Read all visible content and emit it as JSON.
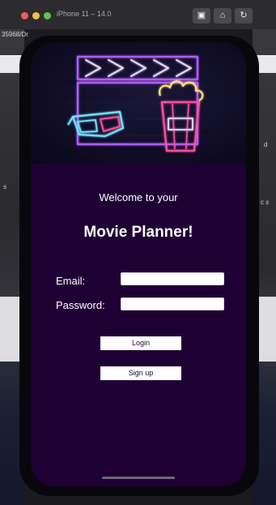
{
  "simulator": {
    "title": "iPhone 11 – 14.0",
    "buttons": {
      "screenshot_icon": "camera-icon",
      "home_icon": "home-icon",
      "rotate_icon": "rotate-icon"
    }
  },
  "background": {
    "path_fragment": "35968/Dr",
    "right_glyph_1": "d",
    "right_glyph_2": "c  s",
    "left_glyph": "s"
  },
  "app": {
    "welcome": "Welcome to your",
    "title": "Movie Planner!",
    "email_label": "Email:",
    "email_value": "",
    "password_label": "Password:",
    "password_value": "",
    "login_label": "Login",
    "signup_label": "Sign up"
  },
  "colors": {
    "screen_bg": "#1f0034",
    "button_text": "#1f0034",
    "neon_purple": "#b05cff",
    "neon_cyan": "#6fe0ff",
    "neon_pink": "#ff4f9a",
    "neon_yellow": "#ffe66d"
  }
}
